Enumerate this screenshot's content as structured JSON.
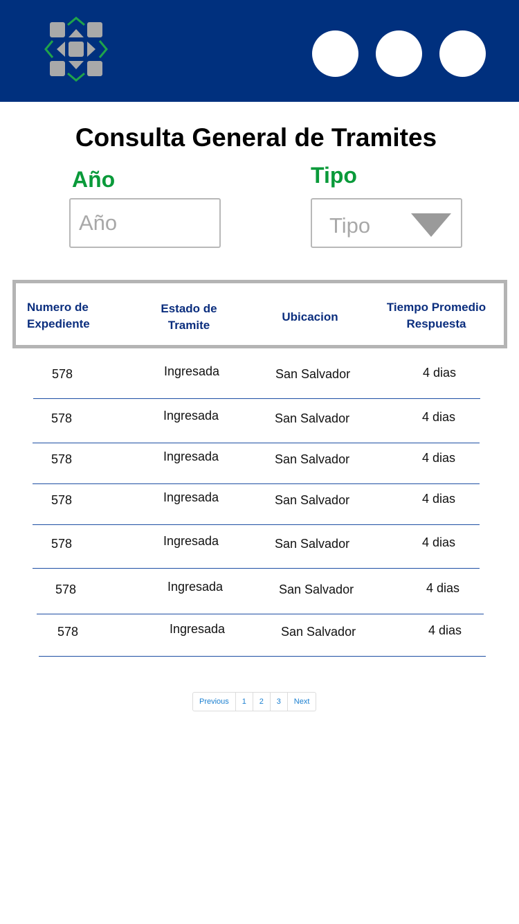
{
  "header": {
    "logo_name": "app-logo",
    "brand_color": "#00307e",
    "actions": [
      "",
      "",
      ""
    ]
  },
  "title": "Consulta General de Tramites",
  "filters": {
    "anio": {
      "label": "Año",
      "placeholder": "Año"
    },
    "tipo": {
      "label": "Tipo",
      "selected": "Tipo"
    }
  },
  "table": {
    "headers": {
      "numero": "Numero de Expediente",
      "estado": "Estado de Tramite",
      "ubicacion": "Ubicacion",
      "tiempo": "Tiempo Promedio Respuesta"
    },
    "rows": [
      {
        "numero": "578",
        "estado": "Ingresada",
        "ubicacion": "San Salvador",
        "tiempo": "4 dias"
      },
      {
        "numero": "578",
        "estado": "Ingresada",
        "ubicacion": "San Salvador",
        "tiempo": "4 dias"
      },
      {
        "numero": "578",
        "estado": "Ingresada",
        "ubicacion": "San Salvador",
        "tiempo": "4 dias"
      },
      {
        "numero": "578",
        "estado": "Ingresada",
        "ubicacion": "San Salvador",
        "tiempo": "4 dias"
      },
      {
        "numero": "578",
        "estado": "Ingresada",
        "ubicacion": "San Salvador",
        "tiempo": "4 dias"
      },
      {
        "numero": "578",
        "estado": "Ingresada",
        "ubicacion": "San Salvador",
        "tiempo": "4 dias"
      },
      {
        "numero": "578",
        "estado": "Ingresada",
        "ubicacion": "San Salvador",
        "tiempo": "4 dias"
      }
    ]
  },
  "pagination": {
    "previous": "Previous",
    "pages": [
      "1",
      "2",
      "3"
    ],
    "next": "Next",
    "link_color": "#1a7fd0"
  }
}
